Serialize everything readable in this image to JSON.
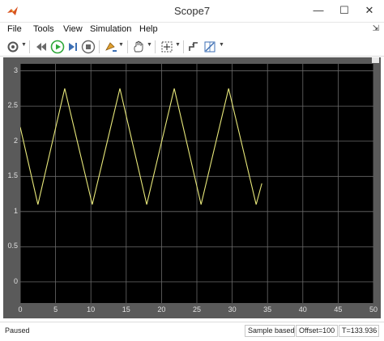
{
  "window": {
    "title": "Scope7",
    "minimize_glyph": "—",
    "maximize_glyph": "☐",
    "close_glyph": "✕"
  },
  "menu": [
    {
      "label": "File"
    },
    {
      "label": "Tools"
    },
    {
      "label": "View"
    },
    {
      "label": "Simulation"
    },
    {
      "label": "Help"
    }
  ],
  "menu_pin_glyph": "⇲",
  "toolbar_icons": [
    "settings-icon",
    "step-back-icon",
    "run-icon",
    "step-forward-icon",
    "stop-icon",
    "highlight-icon",
    "pan-icon",
    "zoom-icon",
    "autoscale-icon",
    "triggers-icon",
    "cursor-measurements-icon"
  ],
  "colors": {
    "signal": "#e8e87a",
    "plot_bg": "#000000",
    "grid": "#6a6a6a",
    "frame": "#5a5a5a",
    "run_green": "#2fa83a"
  },
  "status": {
    "state": "Paused",
    "sample_mode": "Sample based",
    "offset": "Offset=100",
    "time": "T=133.936"
  },
  "chart_data": {
    "type": "line",
    "title": "",
    "xlabel": "",
    "ylabel": "",
    "xlim": [
      0,
      50
    ],
    "ylim": [
      -0.3,
      3.1
    ],
    "x_ticks": [
      0,
      5,
      10,
      15,
      20,
      25,
      30,
      35,
      40,
      45,
      50
    ],
    "y_ticks": [
      0,
      0.5,
      1,
      1.5,
      2,
      2.5,
      3
    ],
    "y_tick_labels": [
      "0",
      "0.5",
      "1",
      "1.5",
      "2",
      "2.5",
      "3"
    ],
    "x_tick_labels": [
      "0",
      "5",
      "10",
      "15",
      "20",
      "25",
      "30",
      "35",
      "40",
      "45",
      "50"
    ],
    "grid": true,
    "series": [
      {
        "x": [
          0,
          2.5,
          6.3,
          10.2,
          14.1,
          17.9,
          21.8,
          25.6,
          29.5,
          33.4,
          34.2
        ],
        "y": [
          2.2,
          1.1,
          2.75,
          1.1,
          2.75,
          1.1,
          2.75,
          1.1,
          2.75,
          1.1,
          1.4
        ]
      }
    ]
  }
}
